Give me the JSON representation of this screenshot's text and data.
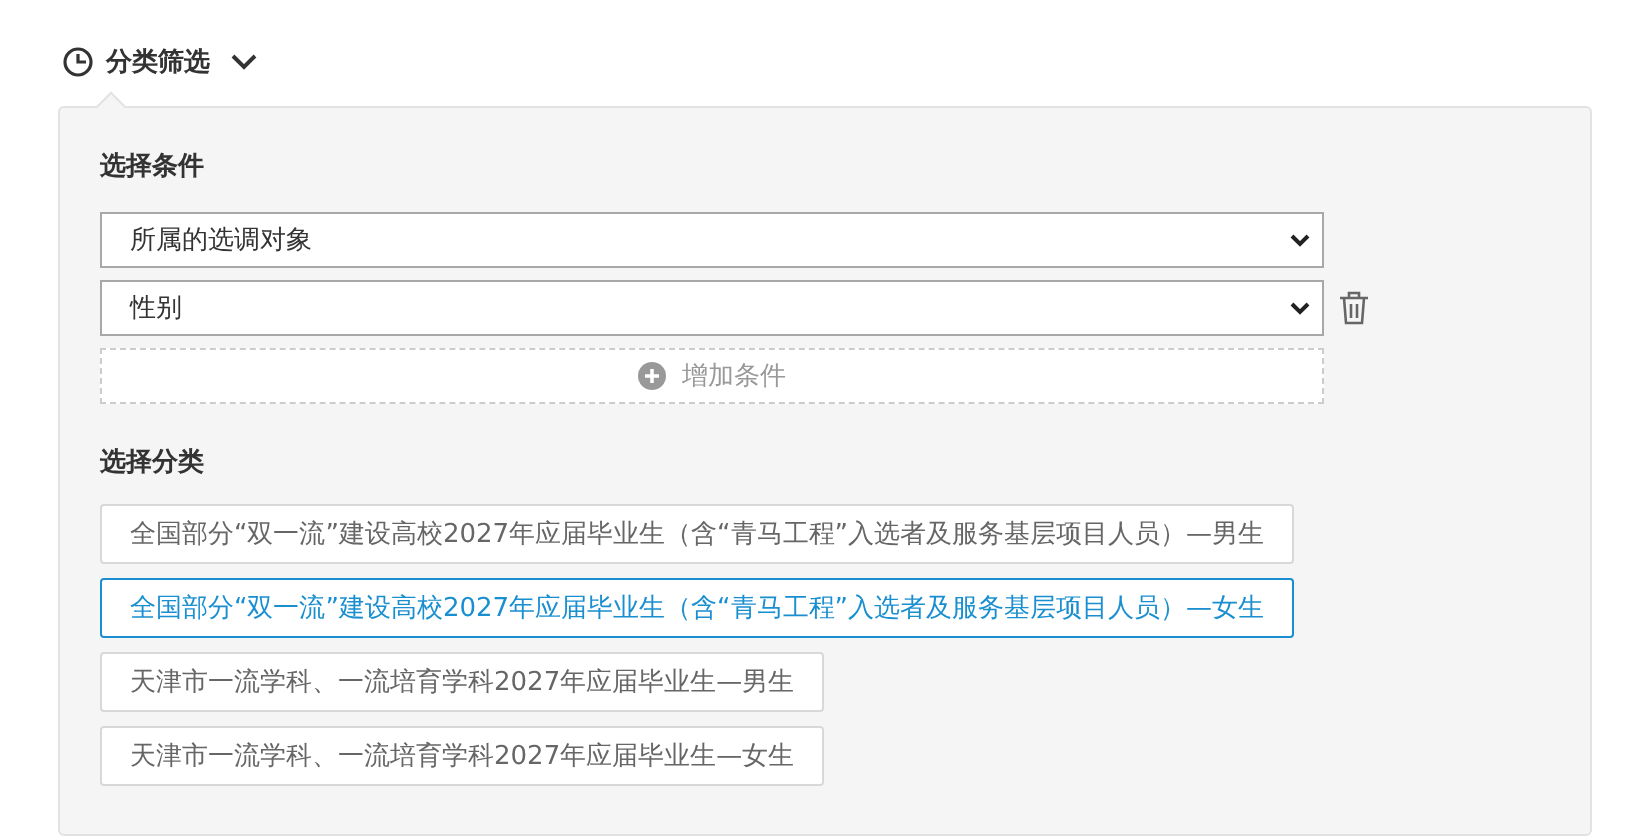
{
  "header": {
    "title": "分类筛选",
    "expanded": true
  },
  "conditions": {
    "heading": "选择条件",
    "dropdowns": [
      {
        "value": "所属的选调对象",
        "deletable": false
      },
      {
        "value": "性别",
        "deletable": true
      }
    ],
    "add_button": "增加条件"
  },
  "categories": {
    "heading": "选择分类",
    "items": [
      {
        "label": "全国部分“双一流”建设高校2027年应届毕业生（含“青马工程”入选者及服务基层项目人员）—男生",
        "selected": false
      },
      {
        "label": "全国部分“双一流”建设高校2027年应届毕业生（含“青马工程”入选者及服务基层项目人员）—女生",
        "selected": true
      },
      {
        "label": "天津市一流学科、一流培育学科2027年应届毕业生—男生",
        "selected": false
      },
      {
        "label": "天津市一流学科、一流培育学科2027年应届毕业生—女生",
        "selected": false
      }
    ]
  }
}
